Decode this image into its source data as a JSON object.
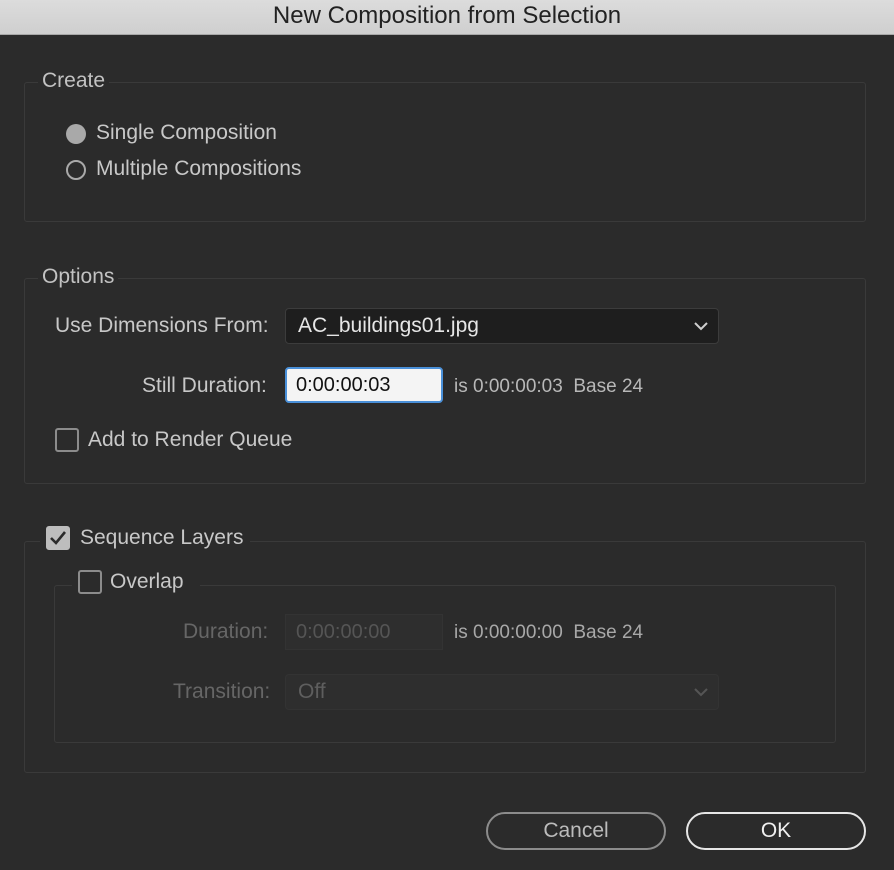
{
  "window": {
    "title": "New Composition from Selection"
  },
  "create": {
    "legend": "Create",
    "options": [
      {
        "label": "Single Composition",
        "selected": true
      },
      {
        "label": "Multiple Compositions",
        "selected": false
      }
    ]
  },
  "options": {
    "legend": "Options",
    "dimensions_label": "Use Dimensions From:",
    "dimensions_value": "AC_buildings01.jpg",
    "still_duration_label": "Still Duration:",
    "still_duration_value": "0:00:00:03",
    "still_duration_info": "is 0:00:00:03  Base 24",
    "render_queue_label": "Add to Render Queue",
    "render_queue_checked": false
  },
  "sequence": {
    "label": "Sequence Layers",
    "checked": true,
    "overlap_label": "Overlap",
    "overlap_checked": false,
    "duration_label": "Duration:",
    "duration_value": "0:00:00:00",
    "duration_info": "is 0:00:00:00  Base 24",
    "transition_label": "Transition:",
    "transition_value": "Off"
  },
  "buttons": {
    "cancel": "Cancel",
    "ok": "OK"
  },
  "colors": {
    "background": "#2b2b2b",
    "focus": "#4a90d9"
  }
}
